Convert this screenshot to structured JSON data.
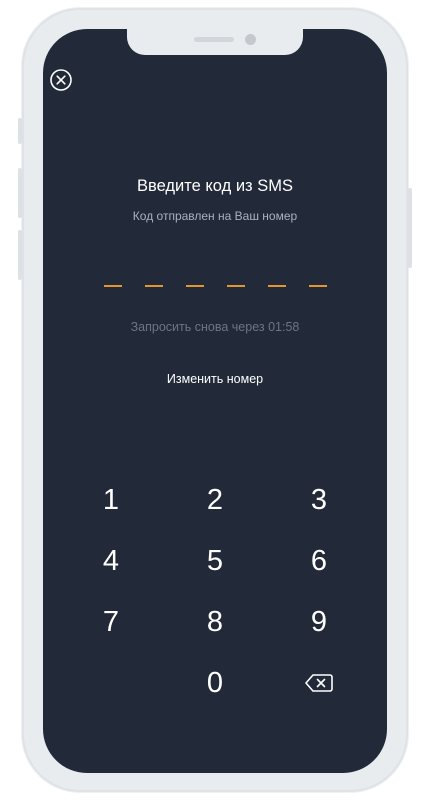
{
  "screen": {
    "title": "Введите код из SMS",
    "subtitle": "Код отправлен на Ваш номер",
    "resend_text": "Запросить снова через 01:58",
    "change_number": "Изменить номер",
    "code_length": 6,
    "code_accent_color": "#e3962f",
    "background_color": "#222a3a"
  },
  "keypad": {
    "keys": [
      "1",
      "2",
      "3",
      "4",
      "5",
      "6",
      "7",
      "8",
      "9",
      "0"
    ],
    "backspace_icon": "backspace-icon"
  },
  "icons": {
    "close": "close-icon"
  }
}
